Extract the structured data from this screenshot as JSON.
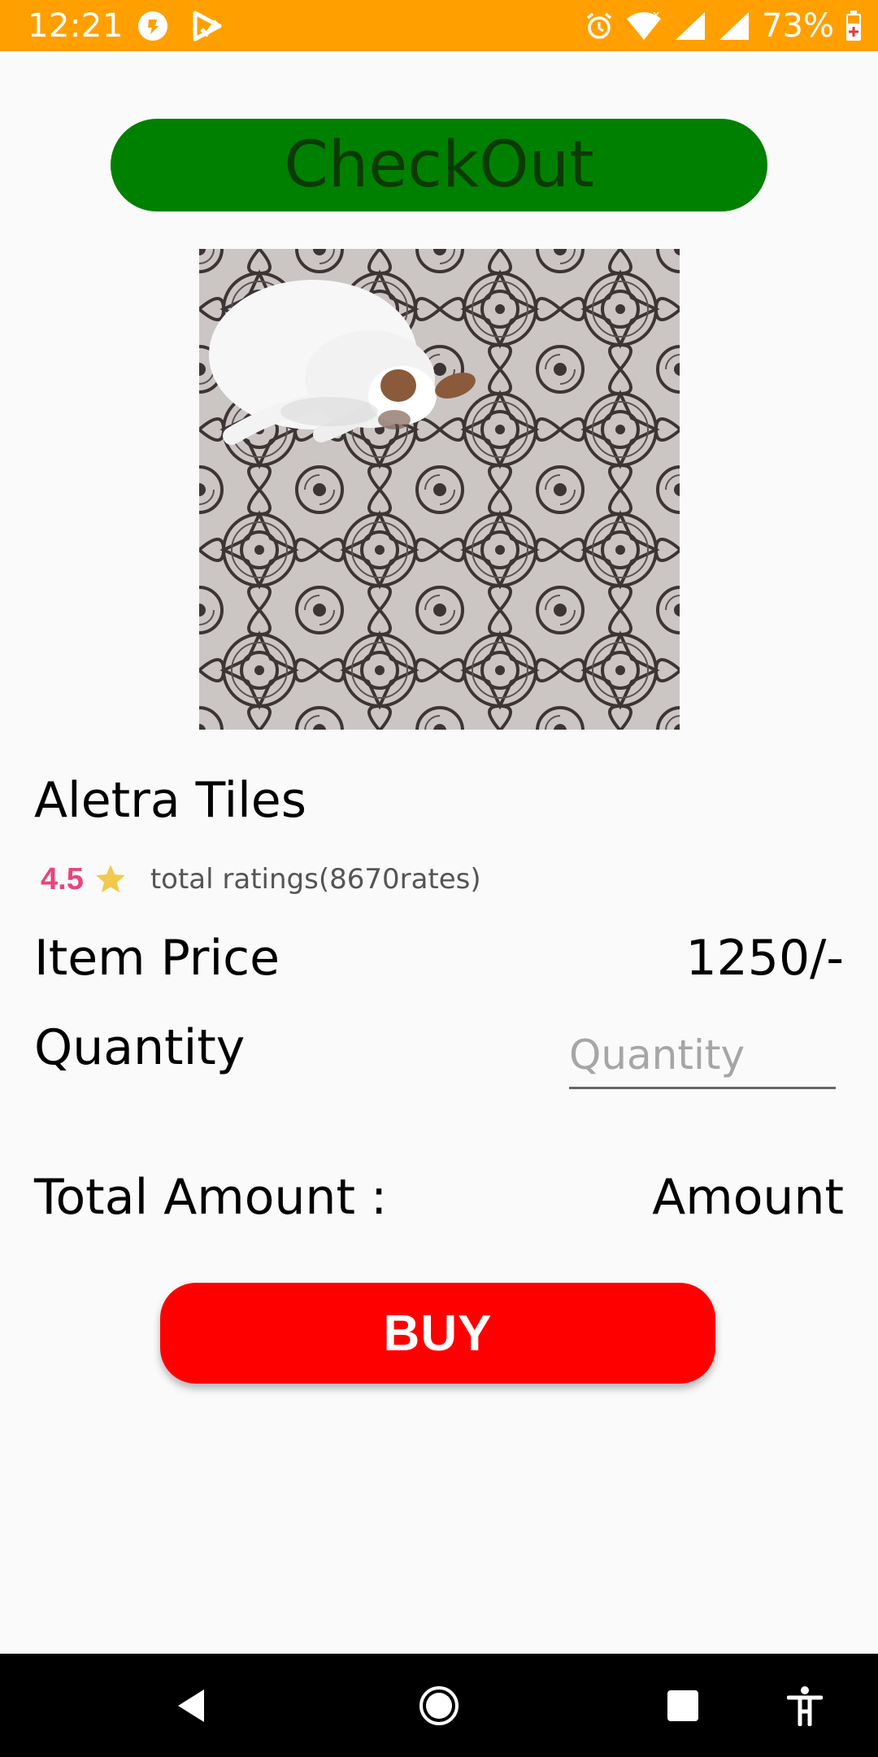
{
  "status_bar": {
    "time": "12:21",
    "battery_percent": "73%",
    "background_color": "#ffa000",
    "left_icons": [
      "notification-badge-icon",
      "play-store-icon"
    ],
    "right_icons": [
      "alarm-icon",
      "wifi-icon",
      "signal-icon",
      "signal-icon",
      "battery-icon"
    ]
  },
  "header": {
    "checkout_label": "CheckOut",
    "checkout_color": "#008000"
  },
  "product": {
    "image_icon": "product-image-tiles-with-dog",
    "title": "Aletra Tiles",
    "rating_value": "4.5",
    "rating_total": "total ratings(8670rates)",
    "rating_color": "#e8457d",
    "star_color": "#f2c94c"
  },
  "details": {
    "price_label": "Item Price",
    "price_value": "1250/-",
    "quantity_label": "Quantity",
    "quantity_placeholder": "Quantity",
    "total_label": "Total Amount :",
    "total_value": "Amount"
  },
  "actions": {
    "buy_label": "BUY",
    "buy_color": "#ff0000"
  },
  "nav_bar": {
    "items": [
      "back-icon",
      "home-icon",
      "recents-icon",
      "accessibility-icon"
    ]
  }
}
